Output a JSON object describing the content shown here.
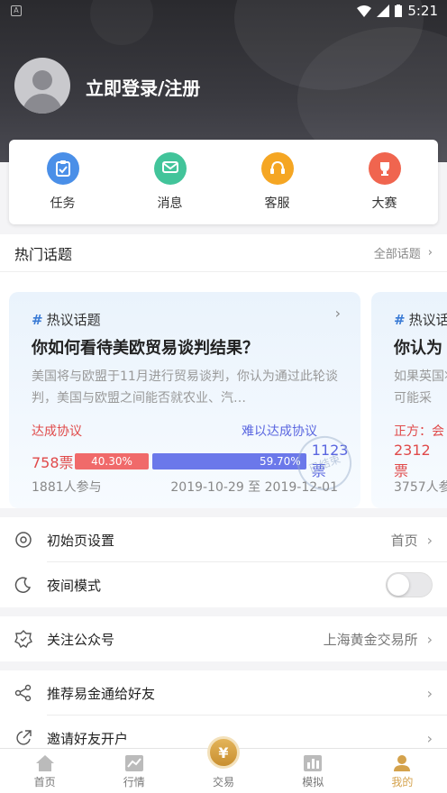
{
  "status_bar": {
    "time": "5:21",
    "left_icon_letter": "A"
  },
  "profile": {
    "login_text": "立即登录/注册"
  },
  "quick_actions": [
    {
      "label": "任务",
      "icon": "clipboard-icon",
      "color": "#4a8fe8"
    },
    {
      "label": "消息",
      "icon": "message-icon",
      "color": "#42c49a"
    },
    {
      "label": "客服",
      "icon": "headset-icon",
      "color": "#f5a623"
    },
    {
      "label": "大赛",
      "icon": "trophy-icon",
      "color": "#f0654f"
    }
  ],
  "hot_topics": {
    "title": "热门话题",
    "all_label": "全部话题",
    "cards": [
      {
        "tag": "热议话题",
        "title": "你如何看待美欧贸易谈判结果？",
        "desc": "美国将与欧盟于11月进行贸易谈判，你认为通过此轮谈判，美国与欧盟之间能否就农业、汽…",
        "left_label": "达成协议",
        "right_label": "难以达成协议",
        "left_count": "758票",
        "right_count": "1123票",
        "left_pct": "40.30%",
        "right_pct": "59.70%",
        "left_fraction": 0.403,
        "participants": "1881人参与",
        "date_range": "2019-10-29 至 2019-12-01",
        "stamp": "已结束"
      },
      {
        "tag": "热议话",
        "title": "你认为",
        "desc": "如果英国将可能采",
        "left_label": "正方：会",
        "left_count": "2312票",
        "participants": "3757人参"
      }
    ]
  },
  "settings": [
    {
      "label": "初始页设置",
      "value": "首页"
    },
    {
      "label": "夜间模式",
      "value": ""
    },
    {
      "label": "关注公众号",
      "value": "上海黄金交易所"
    },
    {
      "label": "推荐易金通给好友",
      "value": ""
    },
    {
      "label": "邀请好友开户",
      "value": ""
    }
  ],
  "bottom_nav": [
    {
      "label": "首页"
    },
    {
      "label": "行情"
    },
    {
      "label": "交易",
      "symbol": "¥"
    },
    {
      "label": "模拟"
    },
    {
      "label": "我的"
    }
  ],
  "colors": {
    "accent_gold": "#d4a24c",
    "agree_red": "#f06a6a",
    "disagree_blue": "#6b78ea"
  }
}
